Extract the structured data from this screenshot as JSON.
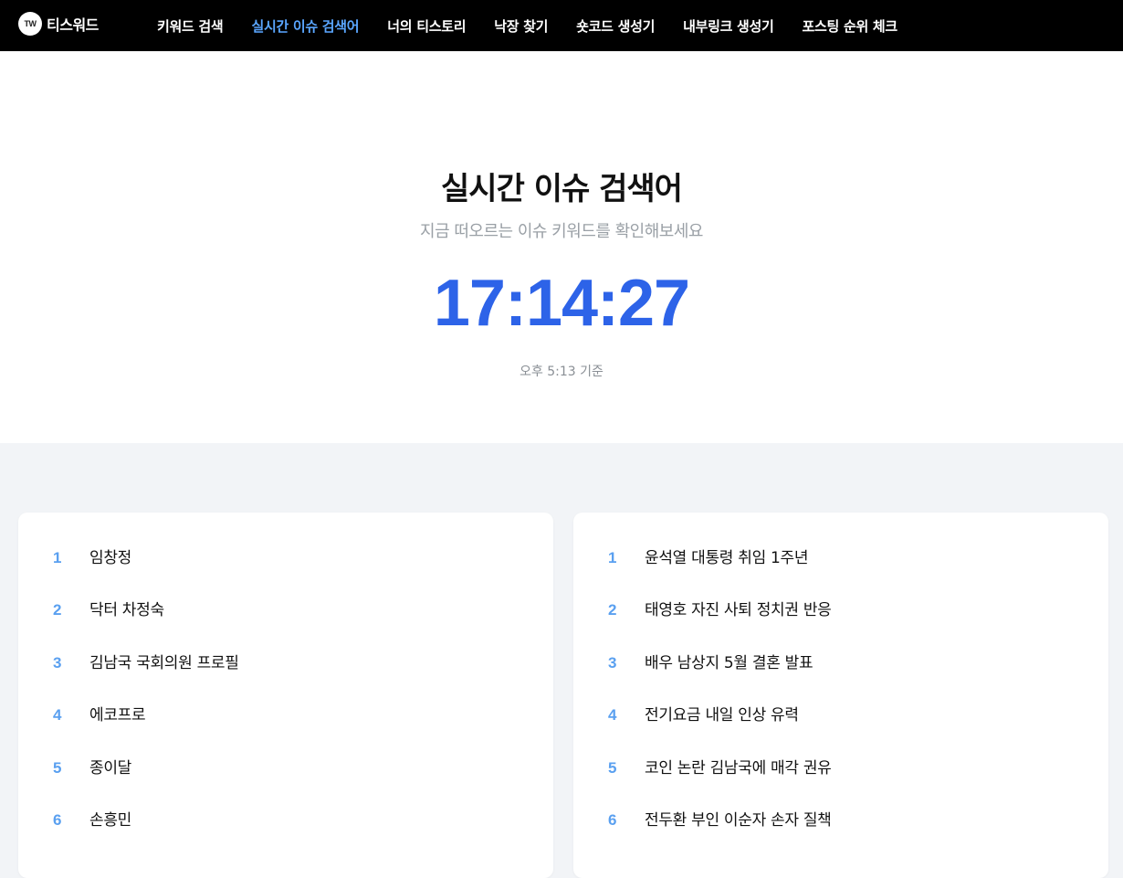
{
  "nav": {
    "brand_logo": "TW",
    "brand_name": "티스워드",
    "items": [
      {
        "label": "키워드 검색"
      },
      {
        "label": "실시간 이슈 검색어"
      },
      {
        "label": "너의 티스토리"
      },
      {
        "label": "낙장 찾기"
      },
      {
        "label": "숏코드 생성기"
      },
      {
        "label": "내부링크 생성기"
      },
      {
        "label": "포스팅 순위 체크"
      }
    ],
    "active_index": 1
  },
  "hero": {
    "title": "실시간 이슈 검색어",
    "subtitle": "지금 떠오르는 이슈 키워드를 확인해보세요",
    "clock": "17:14:27",
    "basis": "오후 5:13 기준"
  },
  "left_list": [
    {
      "rank": "1",
      "keyword": "임창정"
    },
    {
      "rank": "2",
      "keyword": "닥터 차정숙"
    },
    {
      "rank": "3",
      "keyword": "김남국 국회의원 프로필"
    },
    {
      "rank": "4",
      "keyword": "에코프로"
    },
    {
      "rank": "5",
      "keyword": "종이달"
    },
    {
      "rank": "6",
      "keyword": "손흥민"
    }
  ],
  "right_list": [
    {
      "rank": "1",
      "keyword": "윤석열 대통령 취임 1주년"
    },
    {
      "rank": "2",
      "keyword": "태영호 자진 사퇴 정치권 반응"
    },
    {
      "rank": "3",
      "keyword": "배우 남상지 5월 결혼 발표"
    },
    {
      "rank": "4",
      "keyword": "전기요금 내일 인상 유력"
    },
    {
      "rank": "5",
      "keyword": "코인 논란 김남국에 매각 권유"
    },
    {
      "rank": "6",
      "keyword": "전두환 부인 이순자 손자 질책"
    }
  ],
  "colors": {
    "nav_bg": "#000000",
    "nav_active": "#5aa6ff",
    "clock": "#2d63e8",
    "rank_num": "#5aa0f0",
    "page_bg": "#f2f4f7"
  }
}
